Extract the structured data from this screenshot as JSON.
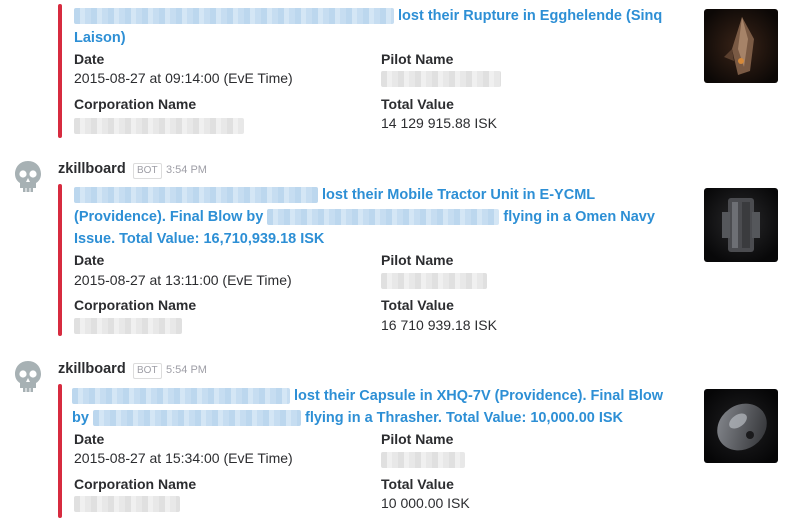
{
  "messages": [
    {
      "title_parts": [
        "lost their Rupture in Egghelende (Sinq",
        "Laison)"
      ],
      "date_label": "Date",
      "date_value": "2015-08-27 at 09:14:00 (EvE Time)",
      "pilot_label": "Pilot Name",
      "corp_label": "Corporation Name",
      "value_label": "Total Value",
      "value": "14 129 915.88 ISK",
      "thumbnail_icon": "rupture-ship-icon"
    },
    {
      "sender": "zkillboard",
      "badge": "BOT",
      "time": "3:54 PM",
      "title_parts": [
        "lost their Mobile Tractor Unit in E-YCML",
        "(Providence). Final Blow by",
        "flying in a Omen Navy",
        "Issue. Total Value: 16,710,939.18 ISK"
      ],
      "date_label": "Date",
      "date_value": "2015-08-27 at 13:11:00 (EvE Time)",
      "pilot_label": "Pilot Name",
      "corp_label": "Corporation Name",
      "value_label": "Total Value",
      "value": "16 710 939.18 ISK",
      "thumbnail_icon": "mobile-tractor-unit-icon"
    },
    {
      "sender": "zkillboard",
      "badge": "BOT",
      "time": "5:54 PM",
      "title_parts": [
        "lost their Capsule in XHQ-7V (Providence). Final Blow",
        "by",
        "flying in a Thrasher. Total Value: 10,000.00 ISK"
      ],
      "date_label": "Date",
      "date_value": "2015-08-27 at 15:34:00 (EvE Time)",
      "pilot_label": "Pilot Name",
      "corp_label": "Corporation Name",
      "value_label": "Total Value",
      "value": "10 000.00 ISK",
      "thumbnail_icon": "capsule-icon"
    }
  ],
  "colors": {
    "accent_bar": "#d72b3f",
    "link": "#2d8fd5"
  }
}
